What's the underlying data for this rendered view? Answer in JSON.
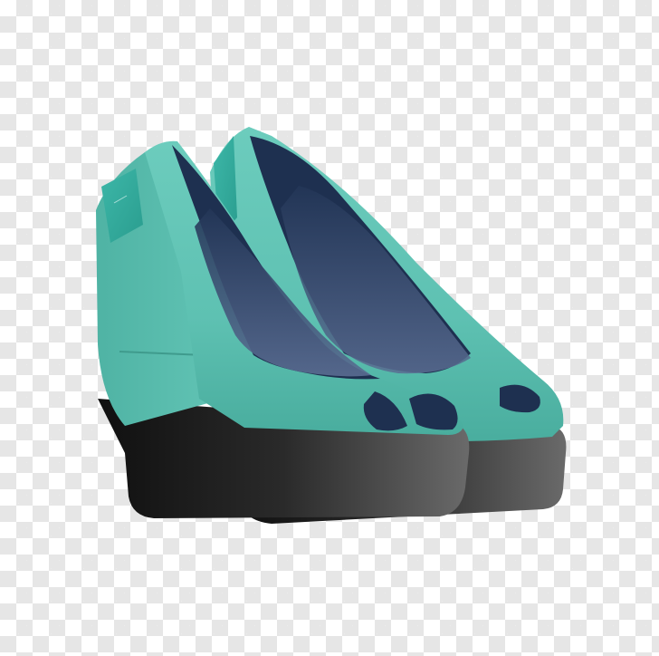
{
  "image": {
    "background_pattern": "transparency-checkerboard",
    "checker_colors": [
      "#ffffff",
      "#e6e6e6"
    ]
  },
  "colors": {
    "upper": "#5ec1b2",
    "upper_dark": "#3a9a8b",
    "lining": "#1e3050",
    "insole": "#4c6086",
    "sole": "#1b1b1b",
    "patch": "#2fa89a"
  }
}
